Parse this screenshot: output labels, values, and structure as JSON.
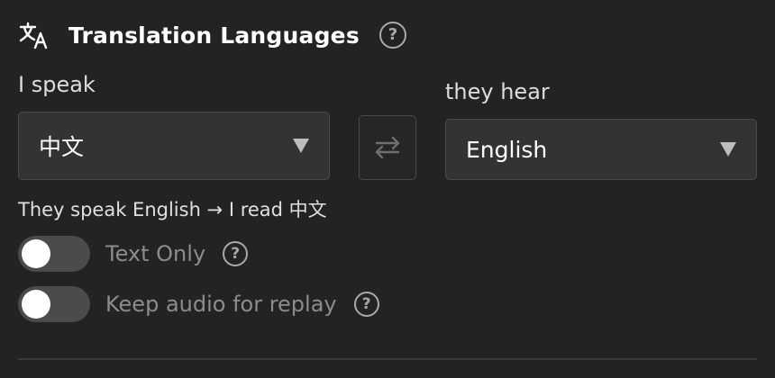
{
  "header": {
    "icon": "translate-icon",
    "title": "Translation Languages",
    "help_icon": "help-icon",
    "help_glyph": "?"
  },
  "speak": {
    "label": "I speak",
    "selected": "中文"
  },
  "hear": {
    "label": "they hear",
    "selected": "English"
  },
  "swap": {
    "icon": "swap-arrows-icon"
  },
  "summary": "They speak English → I read 中文",
  "toggles": [
    {
      "label": "Text Only",
      "on": false,
      "help_glyph": "?"
    },
    {
      "label": "Keep audio for replay",
      "on": false,
      "help_glyph": "?"
    }
  ],
  "colors": {
    "background": "#232323",
    "select_background": "#333333",
    "muted_text": "#8c8c8c",
    "toggle_off": "#4b4b4b"
  }
}
